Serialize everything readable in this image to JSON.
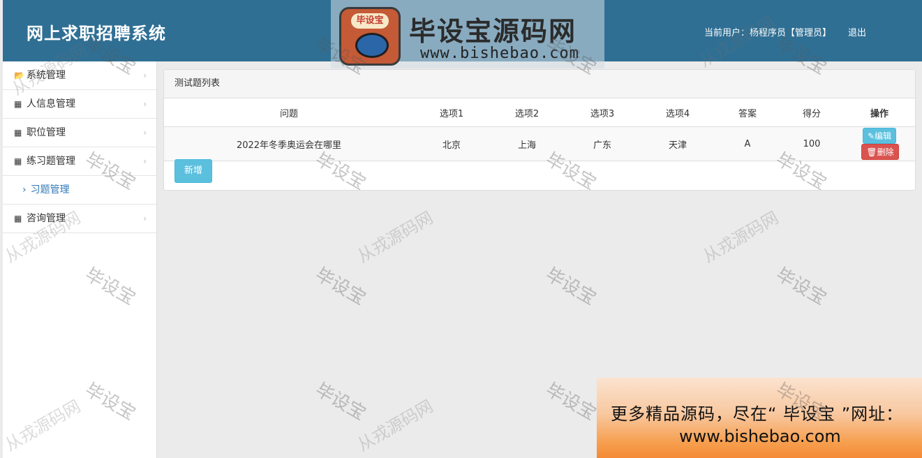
{
  "header": {
    "title": "网上求职招聘系统",
    "current_user": "当前用户：杨程序员【管理员】",
    "logout": "退出"
  },
  "logo_banner": {
    "badge": "毕设宝",
    "name": "毕设宝源码网",
    "url": "www.bishebao.com"
  },
  "sidebar": {
    "items": [
      {
        "label": "系统管理",
        "icon": "folder-open-icon"
      },
      {
        "label": "人信息管理",
        "icon": "grid-icon"
      },
      {
        "label": "职位管理",
        "icon": "grid-icon"
      },
      {
        "label": "练习题管理",
        "icon": "grid-icon"
      },
      {
        "label": "咨询管理",
        "icon": "grid-icon"
      }
    ],
    "sub_item": "习题管理"
  },
  "panel": {
    "title": "测试题列表",
    "columns": [
      "问题",
      "选项1",
      "选项2",
      "选项3",
      "选项4",
      "答案",
      "得分",
      "操作"
    ],
    "rows": [
      {
        "question": "2022年冬季奥运会在哪里",
        "opt1": "北京",
        "opt2": "上海",
        "opt3": "广东",
        "opt4": "天津",
        "answer": "A",
        "score": "100"
      }
    ],
    "edit": "编辑",
    "delete": "删除",
    "add": "新增"
  },
  "promo": {
    "line1": "更多精品源码，尽在“ 毕设宝 ”网址：",
    "line2": "www.bishebao.com"
  },
  "watermarks": {
    "a": "毕设宝",
    "b": "从戎源码网"
  }
}
